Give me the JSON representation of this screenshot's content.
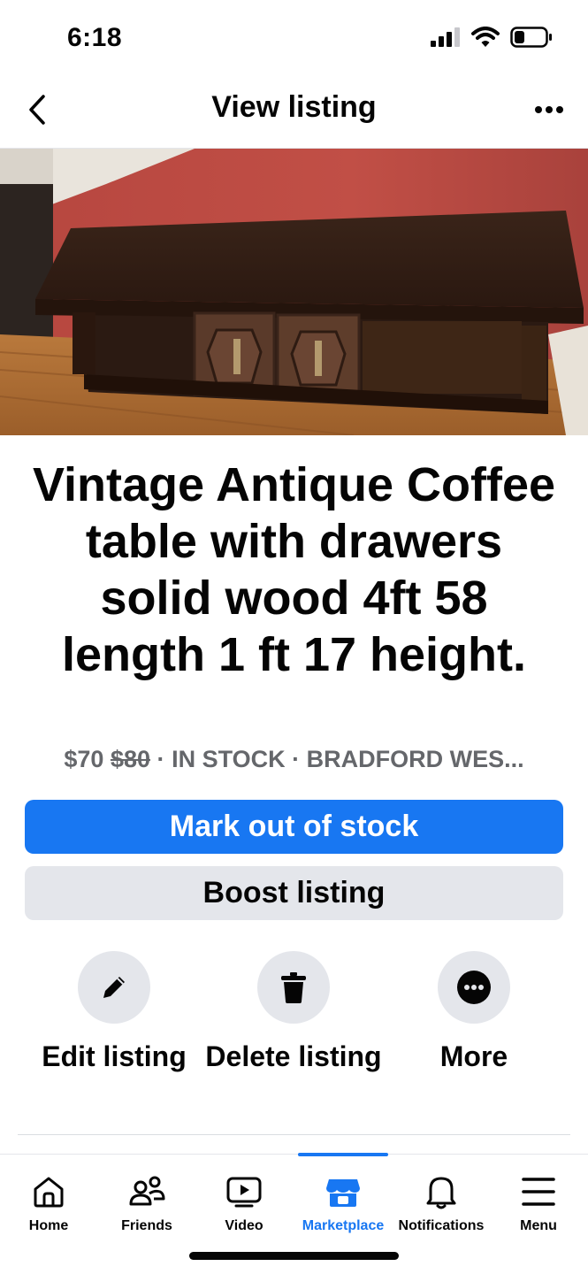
{
  "status_bar": {
    "time": "6:18"
  },
  "header": {
    "title": "View listing",
    "back_icon": "chevron-left-icon",
    "more_icon": "more-horizontal-icon"
  },
  "listing": {
    "title": "Vintage Antique Coffee table with drawers solid wood 4ft 58 length 1 ft 17 height.",
    "price": "$70",
    "original_price": "$80",
    "separator": "·",
    "stock_status": "IN STOCK",
    "location": "BRADFORD WES..."
  },
  "buttons": {
    "mark_out_of_stock": "Mark out of stock",
    "boost_listing": "Boost listing"
  },
  "actions": [
    {
      "label": "Edit listing",
      "icon": "pencil-icon"
    },
    {
      "label": "Delete listing",
      "icon": "trash-icon"
    },
    {
      "label": "More",
      "icon": "more-circle-icon"
    }
  ],
  "tabs": [
    {
      "label": "Home",
      "icon": "home-icon",
      "active": false
    },
    {
      "label": "Friends",
      "icon": "friends-icon",
      "active": false
    },
    {
      "label": "Video",
      "icon": "video-icon",
      "active": false
    },
    {
      "label": "Marketplace",
      "icon": "marketplace-icon",
      "active": true
    },
    {
      "label": "Notifications",
      "icon": "bell-icon",
      "active": false
    },
    {
      "label": "Menu",
      "icon": "menu-icon",
      "active": false
    }
  ],
  "colors": {
    "accent": "#1877f2",
    "secondary_button": "#e4e6eb",
    "meta_text": "#65676b"
  }
}
